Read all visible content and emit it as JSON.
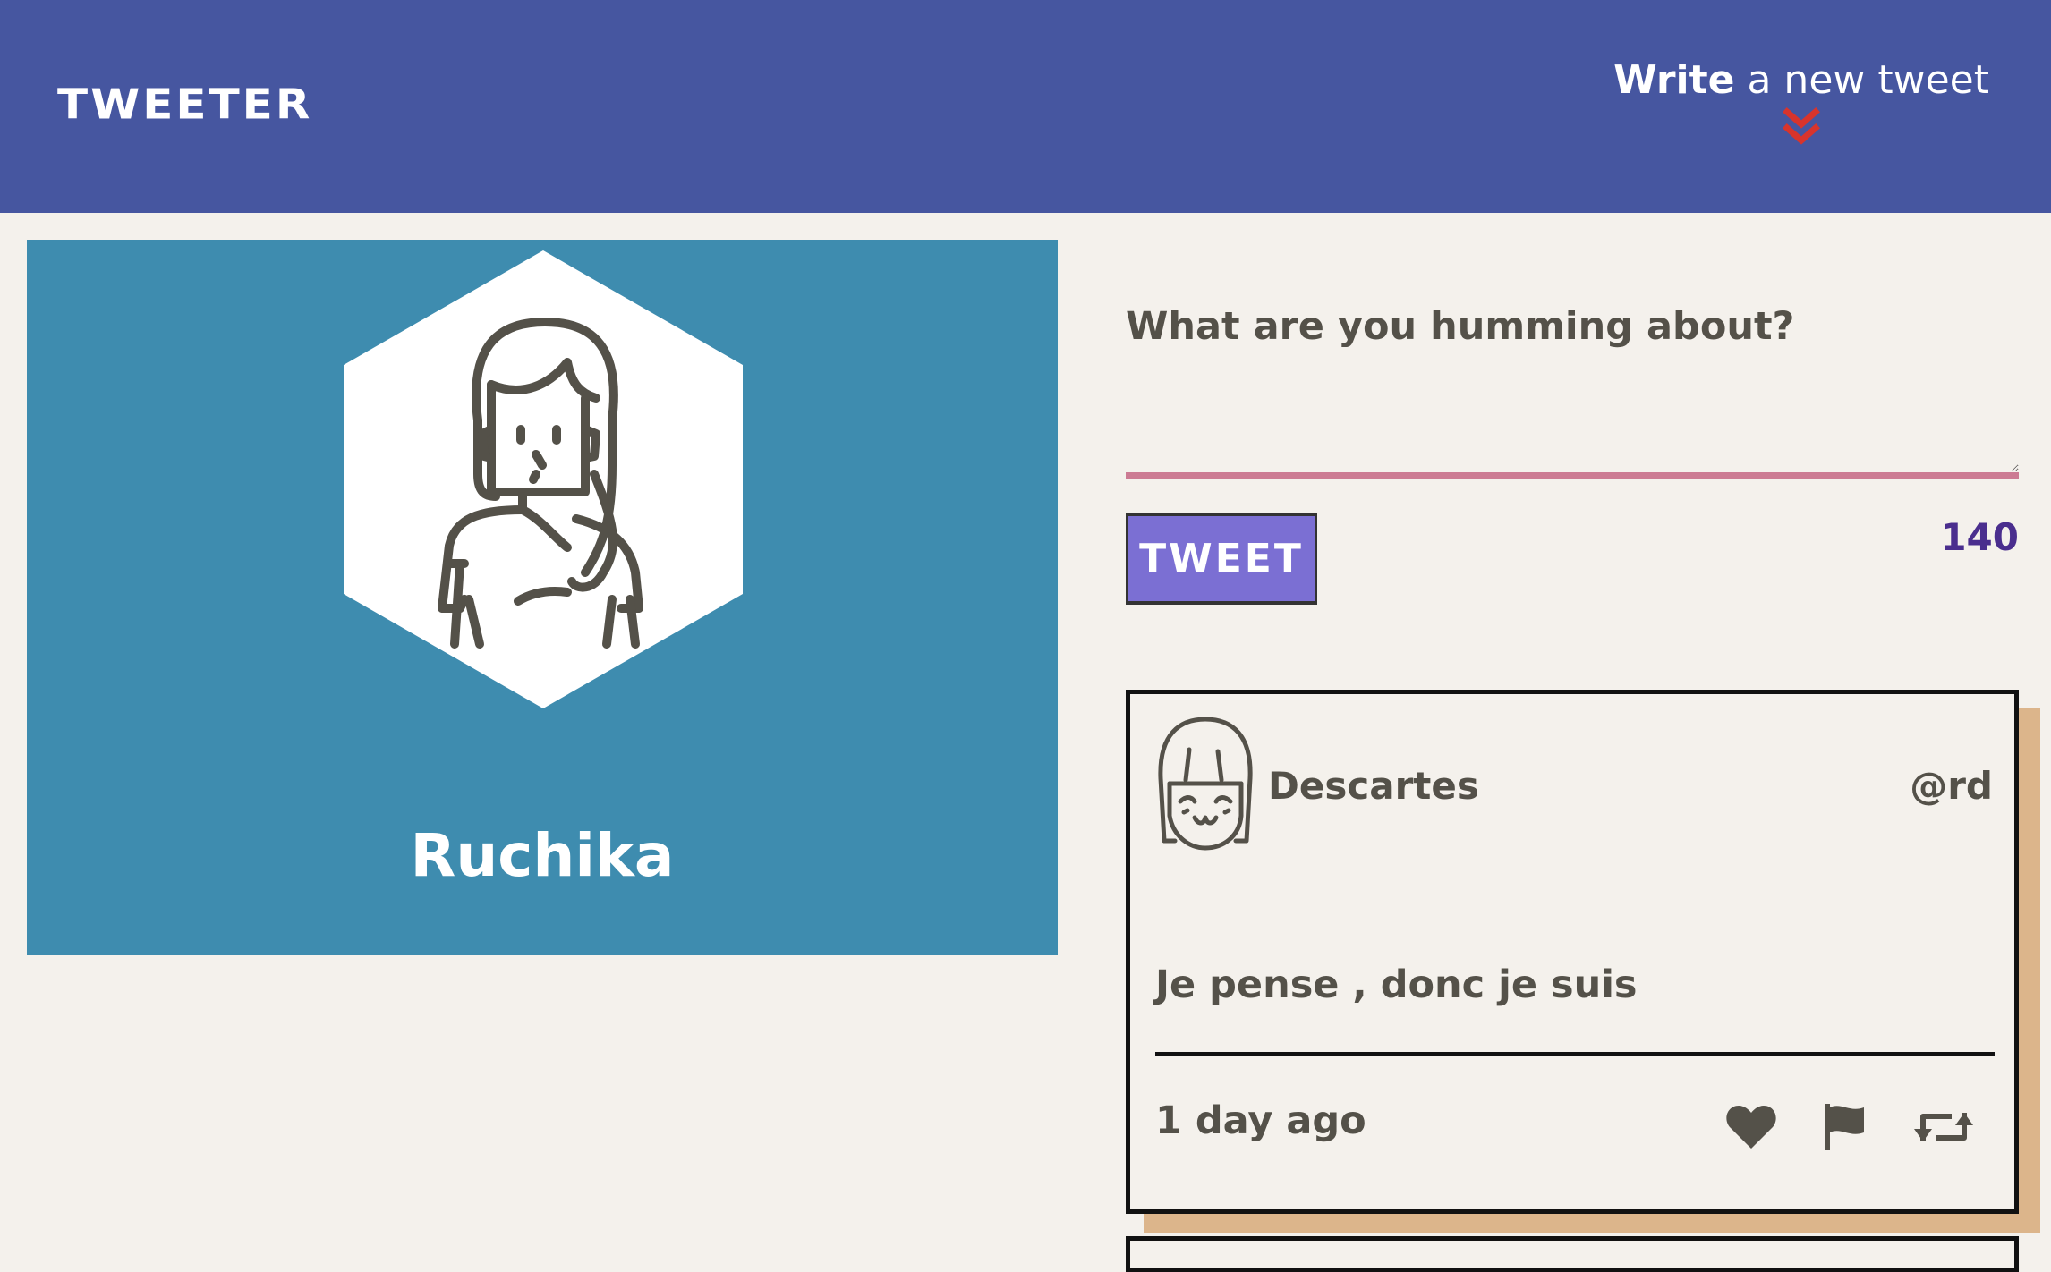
{
  "nav": {
    "brand": "TWEETER",
    "compose_bold": "Write",
    "compose_rest": " a new tweet",
    "chevron_icon": "double-chevron-down-icon",
    "chevron_color": "#d8342c"
  },
  "profile": {
    "name": "Ruchika",
    "avatar_icon": "woman-avatar-icon"
  },
  "composer": {
    "label": "What are you humming about?",
    "text_value": "",
    "button_label": "TWEET",
    "char_counter": "140"
  },
  "tweet": {
    "author_name": "Descartes",
    "handle": "@rd",
    "avatar_icon": "girl-avatar-icon",
    "content": "Je pense , donc je suis",
    "timestamp": "1 day ago",
    "actions": {
      "like_icon": "heart-icon",
      "flag_icon": "flag-icon",
      "retweet_icon": "retweet-icon"
    }
  },
  "colors": {
    "nav_bg": "#4656a0",
    "profile_bg": "#3e8caf",
    "page_bg": "#f4f1ec",
    "tweet_button_bg": "#7b6fd3",
    "textarea_underline": "#cc7b93",
    "counter_text": "#4a2e8e",
    "card_shadow": "#dcb58b"
  }
}
